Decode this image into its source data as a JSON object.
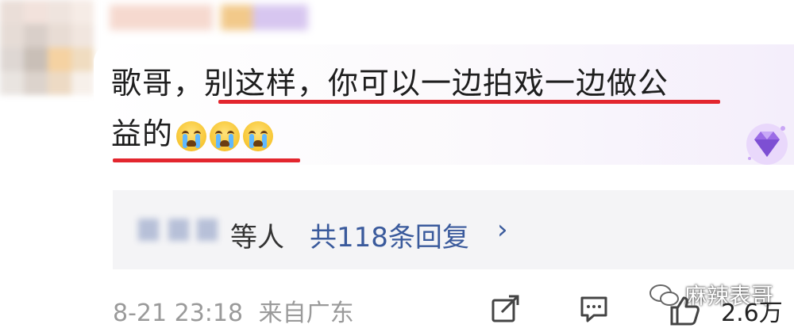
{
  "comment": {
    "line1": "歌哥，别这样，你可以一边拍戏一边做公",
    "line2": "益的",
    "emojis": [
      "crying-emoji",
      "crying-emoji",
      "crying-emoji"
    ]
  },
  "replies": {
    "others_label": "等人",
    "count_label": "共118条回复",
    "chevron": "›"
  },
  "footer": {
    "timestamp": "8-21 23:18",
    "location": "来自广东",
    "likes": "2.6万"
  },
  "watermark": {
    "text": "麻辣表哥"
  },
  "colors": {
    "link_blue": "#3a5a9c",
    "underline_red": "#e3262e",
    "meta_gray": "#9a9a9a"
  }
}
